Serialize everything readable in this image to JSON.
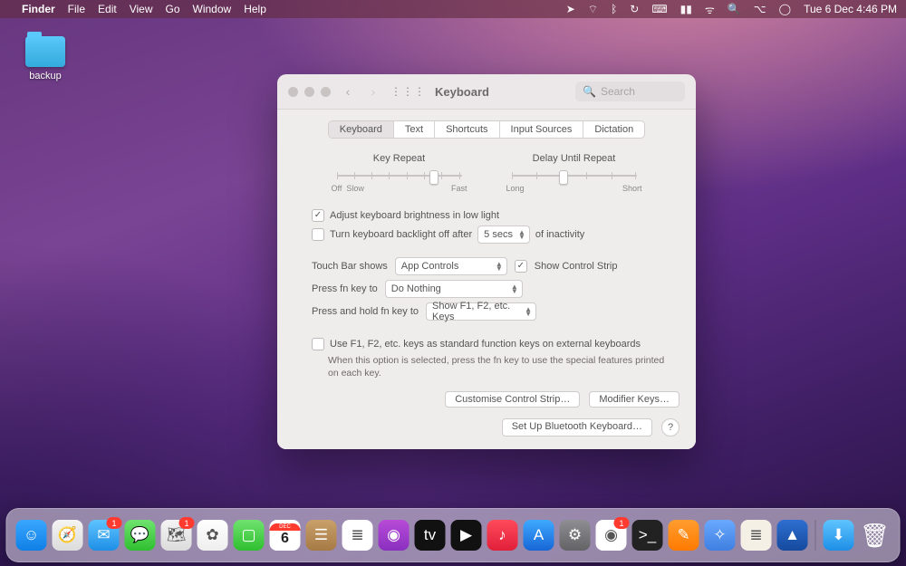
{
  "menubar": {
    "app": "Finder",
    "items": [
      "File",
      "Edit",
      "View",
      "Go",
      "Window",
      "Help"
    ],
    "clock": "Tue 6 Dec  4:46 PM"
  },
  "desktop": {
    "folder_label": "backup"
  },
  "window": {
    "title": "Keyboard",
    "search_placeholder": "Search",
    "tabs": [
      "Keyboard",
      "Text",
      "Shortcuts",
      "Input Sources",
      "Dictation"
    ],
    "active_tab": 0,
    "slider1": {
      "caption": "Key Repeat",
      "left": "Off",
      "left2": "Slow",
      "right": "Fast",
      "knob_pct": 78
    },
    "slider2": {
      "caption": "Delay Until Repeat",
      "left": "Long",
      "right": "Short",
      "knob_pct": 42
    },
    "adjust_brightness": {
      "checked": true,
      "label": "Adjust keyboard brightness in low light"
    },
    "backlight_off": {
      "checked": false,
      "label": "Turn keyboard backlight off after",
      "value": "5 secs",
      "suffix": "of inactivity"
    },
    "touchbar": {
      "label": "Touch Bar shows",
      "value": "App Controls"
    },
    "show_strip": {
      "checked": true,
      "label": "Show Control Strip"
    },
    "fn": {
      "label": "Press fn key to",
      "value": "Do Nothing"
    },
    "fnhold": {
      "label": "Press and hold fn key to",
      "value": "Show F1, F2, etc. Keys"
    },
    "stdfn": {
      "checked": false,
      "label": "Use F1, F2, etc. keys as standard function keys on external keyboards",
      "hint": "When this option is selected, press the fn key to use the special features printed on each key."
    },
    "btn_customise": "Customise Control Strip…",
    "btn_modifier": "Modifier Keys…",
    "btn_bluetooth": "Set Up Bluetooth Keyboard…",
    "help": "?"
  },
  "dock": {
    "items": [
      {
        "name": "finder",
        "bg": "linear-gradient(#39a7ff,#0f7fe6)",
        "glyph": "☺"
      },
      {
        "name": "safari",
        "bg": "linear-gradient(#f4f4f4,#dcdcdc)",
        "glyph": "🧭"
      },
      {
        "name": "mail",
        "bg": "linear-gradient(#5fc4ff,#1e8fe6)",
        "glyph": "✉",
        "badge": "1"
      },
      {
        "name": "messages",
        "bg": "linear-gradient(#6fe36f,#2fbf2f)",
        "glyph": "💬"
      },
      {
        "name": "maps",
        "bg": "linear-gradient(#f4f4f4,#dcdcdc)",
        "glyph": "🗺",
        "badge": "1"
      },
      {
        "name": "photos",
        "bg": "linear-gradient(#fff,#eee)",
        "glyph": "✿"
      },
      {
        "name": "facetime",
        "bg": "linear-gradient(#6fe36f,#2fbf2f)",
        "glyph": "▢"
      },
      {
        "name": "calendar",
        "bg": "#fff",
        "glyph": "6",
        "extra": "cal"
      },
      {
        "name": "contacts",
        "bg": "linear-gradient(#c9a06a,#a67a44)",
        "glyph": "☰"
      },
      {
        "name": "reminders",
        "bg": "#fff",
        "glyph": "≣"
      },
      {
        "name": "podcasts",
        "bg": "linear-gradient(#b84bd8,#8a2fbf)",
        "glyph": "◉"
      },
      {
        "name": "tv",
        "bg": "#111",
        "glyph": "tv"
      },
      {
        "name": "apple-tv",
        "bg": "#111",
        "glyph": "▶"
      },
      {
        "name": "music",
        "bg": "linear-gradient(#ff4b5c,#e11f3a)",
        "glyph": "♪"
      },
      {
        "name": "app-store",
        "bg": "linear-gradient(#3ea9ff,#1866d6)",
        "glyph": "A"
      },
      {
        "name": "system-prefs",
        "bg": "linear-gradient(#8e8e93,#636366)",
        "glyph": "⚙"
      },
      {
        "name": "chrome",
        "bg": "#fff",
        "glyph": "◉",
        "badge": "1"
      },
      {
        "name": "terminal",
        "bg": "#222",
        "glyph": ">_"
      },
      {
        "name": "pages",
        "bg": "linear-gradient(#ff9d2f,#ff7a00)",
        "glyph": "✎"
      },
      {
        "name": "tools",
        "bg": "linear-gradient(#6aa9ff,#3f7fe0)",
        "glyph": "✧"
      },
      {
        "name": "textedit",
        "bg": "#f4f0e6",
        "glyph": "≣"
      },
      {
        "name": "nordvpn",
        "bg": "linear-gradient(#2f6fd1,#154a9e)",
        "glyph": "▲"
      }
    ],
    "downloads": {
      "name": "downloads",
      "bg": "linear-gradient(#5fc4ff,#1e8fe6)",
      "glyph": "⬇"
    },
    "trash": {
      "name": "trash",
      "bg": "rgba(255,255,255,.0)",
      "glyph": "🗑"
    }
  }
}
